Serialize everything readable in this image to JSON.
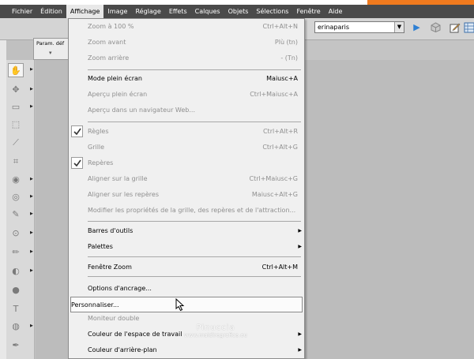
{
  "menubar": {
    "items": [
      "Fichier",
      "Édition",
      "Affichage",
      "Image",
      "Réglage",
      "Effets",
      "Calques",
      "Objets",
      "Sélections",
      "Fenêtre",
      "Aide"
    ],
    "active": "Affichage"
  },
  "toolbar": {
    "workspace_value": "erinaparis",
    "icons": [
      "play-icon",
      "cube-icon",
      "edit-icon",
      "grid-icon"
    ]
  },
  "options_tab": {
    "label": "Param. déf"
  },
  "tools": [
    "pan-icon",
    "move-icon",
    "selection-icon",
    "marquee-icon",
    "eyedropper-icon",
    "crop-icon",
    "eye-icon",
    "paint-icon",
    "brush-icon",
    "target-icon",
    "pencil-icon",
    "fill-icon",
    "dropper-icon",
    "text-icon",
    "shape-icon",
    "pen-icon"
  ],
  "menu": {
    "items": [
      {
        "label": "Zoom à 100 %",
        "shortcut": "Ctrl+Alt+N",
        "disabled": true
      },
      {
        "label": "Zoom avant",
        "shortcut": "Plù (tn)",
        "disabled": true
      },
      {
        "label": "Zoom arrière",
        "shortcut": "- (Tn)",
        "disabled": true
      },
      {
        "label": "Mode plein écran",
        "shortcut": "Maiusc+A",
        "disabled": false
      },
      {
        "label": "Aperçu plein écran",
        "shortcut": "Ctrl+Maiusc+A",
        "disabled": true
      },
      {
        "label": "Aperçu dans un navigateur Web...",
        "shortcut": "",
        "disabled": true
      },
      {
        "label": "Règles",
        "shortcut": "Ctrl+Alt+R",
        "disabled": true,
        "checked": true
      },
      {
        "label": "Grille",
        "shortcut": "Ctrl+Alt+G",
        "disabled": true
      },
      {
        "label": "Repères",
        "shortcut": "",
        "disabled": true,
        "checked": true
      },
      {
        "label": "Aligner sur la grille",
        "shortcut": "Ctrl+Maiusc+G",
        "disabled": true
      },
      {
        "label": "Aligner sur les repères",
        "shortcut": "Maiusc+Alt+G",
        "disabled": true
      },
      {
        "label": "Modifier les propriétés de la grille, des repères et de l'attraction...",
        "shortcut": "",
        "disabled": true
      },
      {
        "label": "Barres d'outils",
        "shortcut": "",
        "disabled": false,
        "submenu": true
      },
      {
        "label": "Palettes",
        "shortcut": "",
        "disabled": false,
        "submenu": true
      },
      {
        "label": "Fenêtre Zoom",
        "shortcut": "Ctrl+Alt+M",
        "disabled": false
      },
      {
        "label": "Options d'ancrage...",
        "shortcut": "",
        "disabled": false
      },
      {
        "label": "Personnaliser...",
        "shortcut": "",
        "disabled": false,
        "hover": true
      },
      {
        "label": "Moniteur double",
        "shortcut": "",
        "disabled": true
      },
      {
        "label": "Couleur de l'espace de travail",
        "shortcut": "",
        "disabled": false,
        "submenu": true
      },
      {
        "label": "Couleur d'arrière-plan",
        "shortcut": "",
        "disabled": false,
        "submenu": true
      }
    ]
  },
  "watermark": {
    "name": "Pinuccia",
    "site": "www.maidiregrafica.eu"
  }
}
